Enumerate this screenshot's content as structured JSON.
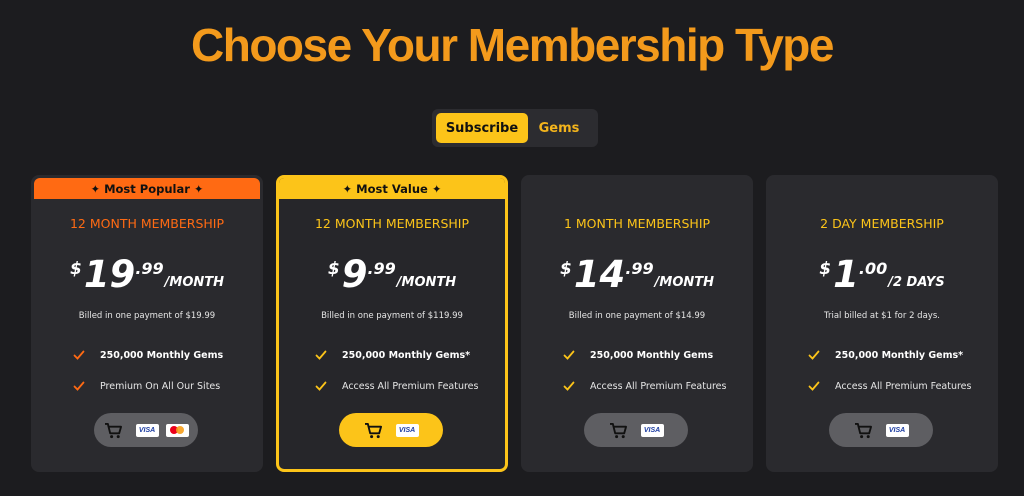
{
  "page": {
    "title": "Choose Your Membership Type",
    "colors": {
      "accent_orange": "#ff6a13",
      "accent_yellow": "#fcc419",
      "title_orange": "#f39a1c",
      "background": "#1c1c1f",
      "card": "#2a2a2e"
    }
  },
  "toggle": {
    "subscribe_label": "Subscribe",
    "gems_label": "Gems",
    "selected": "Subscribe"
  },
  "plans": [
    {
      "ribbon": "✦ Most Popular ✦",
      "name": "12 MONTH MEMBERSHIP",
      "currency": "$",
      "whole": "19",
      "cents": ".99",
      "period": "/MONTH",
      "billed": "Billed in one payment of $19.99",
      "features": [
        "250,000 Monthly Gems",
        "Premium On All Our Sites"
      ],
      "payment_icons": [
        "cart-icon",
        "visa-icon",
        "mastercard-icon"
      ]
    },
    {
      "ribbon": "✦ Most Value ✦",
      "name": "12 MONTH MEMBERSHIP",
      "currency": "$",
      "whole": "9",
      "cents": ".99",
      "period": "/MONTH",
      "billed": "Billed in one payment of $119.99",
      "features": [
        "250,000 Monthly Gems*",
        "Access All Premium Features"
      ],
      "payment_icons": [
        "cart-icon",
        "visa-icon"
      ]
    },
    {
      "name": "1 MONTH MEMBERSHIP",
      "currency": "$",
      "whole": "14",
      "cents": ".99",
      "period": "/MONTH",
      "billed": "Billed in one payment of $14.99",
      "features": [
        "250,000 Monthly Gems",
        "Access All Premium Features"
      ],
      "payment_icons": [
        "cart-icon",
        "visa-icon"
      ]
    },
    {
      "name": "2 DAY MEMBERSHIP",
      "currency": "$",
      "whole": "1",
      "cents": ".00",
      "period": "/2 DAYS",
      "billed": "Trial billed at $1 for 2 days.",
      "features": [
        "250,000 Monthly Gems*",
        "Access All Premium Features"
      ],
      "payment_icons": [
        "cart-icon",
        "visa-icon"
      ]
    }
  ],
  "visa_label": "VISA"
}
